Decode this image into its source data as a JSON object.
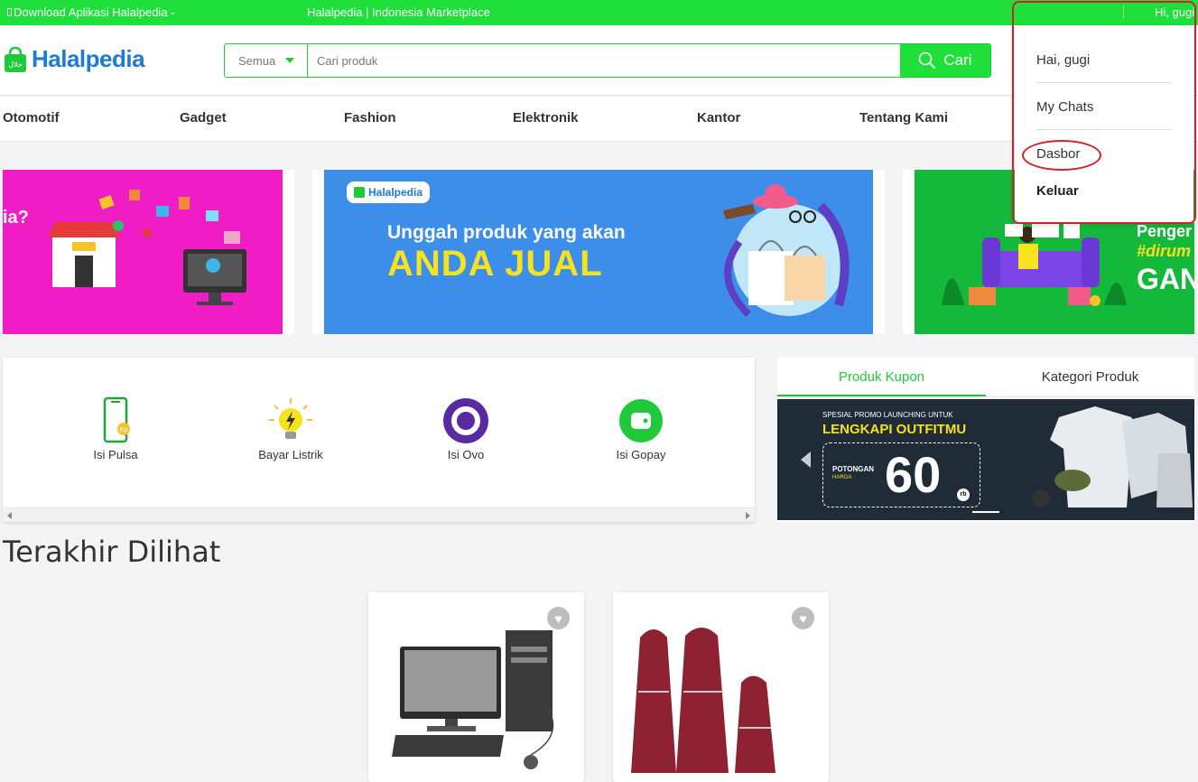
{
  "topbar": {
    "download_label": "Download Aplikasi Halalpedia",
    "tagline": "Halalpedia | Indonesia Marketplace",
    "greeting": "Hi, gugi"
  },
  "header": {
    "logo_text": "Halalpedia",
    "search": {
      "category": "Semua",
      "placeholder": "Cari produk",
      "button_label": "Cari"
    }
  },
  "nav": {
    "items": [
      "Otomotif",
      "Gadget",
      "Fashion",
      "Elektronik",
      "Kantor",
      "Tentang Kami"
    ]
  },
  "banners": {
    "b1_text": "ia?",
    "b2_brand": "Halalpedia",
    "b2_line1": "Unggah produk yang akan",
    "b2_line2": "ANDA JUAL",
    "b3_line1": "Penger",
    "b3_line2": "#dirum",
    "b3_line3": "GAN"
  },
  "services": [
    {
      "label": "Isi Pulsa",
      "icon": "phone-icon"
    },
    {
      "label": "Bayar Listrik",
      "icon": "lightbulb-icon"
    },
    {
      "label": "Isi Ovo",
      "icon": "ovo-icon"
    },
    {
      "label": "Isi Gopay",
      "icon": "gopay-icon"
    }
  ],
  "coupon": {
    "tabs": [
      "Produk Kupon",
      "Kategori Produk"
    ],
    "active_tab": 0,
    "promo": {
      "small": "SPESIAL PROMO LAUNCHING UNTUK",
      "headline": "LENGKAPI OUTFITMU",
      "potongan": "POTONGAN",
      "harga": "HARGA",
      "amount": "60",
      "unit": "rb"
    }
  },
  "recent": {
    "title": "Terakhir Dilihat"
  },
  "dropdown": {
    "greeting": "Hai, gugi",
    "chats": "My Chats",
    "dashboard": "Dasbor",
    "logout": "Keluar"
  },
  "colors": {
    "brand_green": "#1fe03a",
    "brand_blue": "#1d7bd6",
    "annotation_red": "#d0222b"
  }
}
